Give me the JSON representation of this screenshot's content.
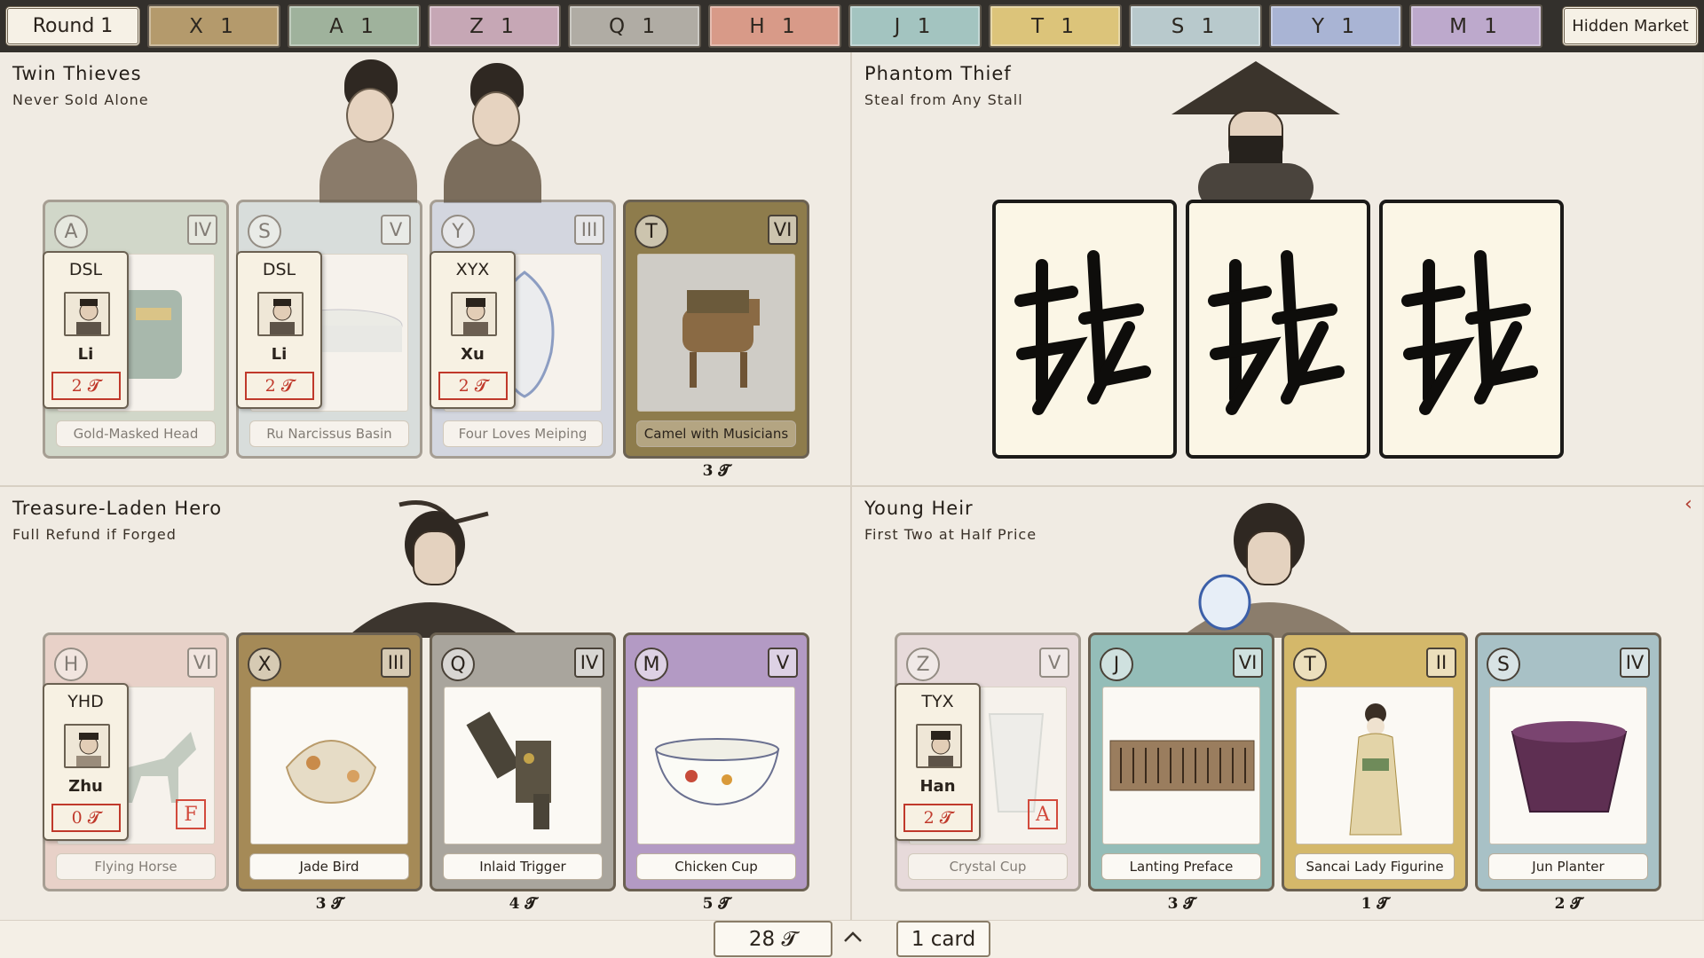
{
  "topbar": {
    "round_label": "Round 1",
    "hidden_market_label": "Hidden Market",
    "tabs": [
      {
        "label": "X 1",
        "color": "#b49a6c"
      },
      {
        "label": "A 1",
        "color": "#9fb29c"
      },
      {
        "label": "Z 1",
        "color": "#c6a7b5"
      },
      {
        "label": "Q 1",
        "color": "#b0aca4"
      },
      {
        "label": "H 1",
        "color": "#d89a88"
      },
      {
        "label": "J 1",
        "color": "#a3c4c0"
      },
      {
        "label": "T 1",
        "color": "#dcc47a"
      },
      {
        "label": "S 1",
        "color": "#b8c9cc"
      },
      {
        "label": "Y 1",
        "color": "#a9b4d4"
      },
      {
        "label": "M 1",
        "color": "#bda9cc"
      }
    ]
  },
  "quadrants": {
    "twin_thieves": {
      "title": "Twin Thieves",
      "subtitle": "Never Sold Alone",
      "cards": [
        {
          "letter": "A",
          "numeral": "IV",
          "name": "Gold-Masked Head",
          "color": "#b9c8b4",
          "buyer": {
            "code": "DSL",
            "name": "Li",
            "price": "2 𝓣"
          }
        },
        {
          "letter": "S",
          "numeral": "V",
          "name": "Ru Narcissus Basin",
          "color": "#c6d2d5",
          "buyer": {
            "code": "DSL",
            "name": "Li",
            "price": "2 𝓣"
          }
        },
        {
          "letter": "Y",
          "numeral": "III",
          "name": "Four Loves Meiping",
          "color": "#bcc5dc",
          "buyer": {
            "code": "XYX",
            "name": "Xu",
            "price": "2 𝓣"
          }
        },
        {
          "letter": "T",
          "numeral": "VI",
          "name": "Camel with Musicians",
          "color": "#8e7c4c",
          "price": "3 𝓣"
        }
      ]
    },
    "phantom_thief": {
      "title": "Phantom Thief",
      "subtitle": "Steal from Any Stall"
    },
    "treasure_hero": {
      "title": "Treasure-Laden Hero",
      "subtitle": "Full Refund if Forged",
      "cards": [
        {
          "letter": "H",
          "numeral": "VI",
          "name": "Flying Horse",
          "color": "#e2bdb2",
          "buyer": {
            "code": "YHD",
            "name": "Zhu",
            "price": "0 𝓣"
          },
          "stamp": "F"
        },
        {
          "letter": "X",
          "numeral": "III",
          "name": "Jade Bird",
          "color": "#a58a57",
          "price": "3 𝓣"
        },
        {
          "letter": "Q",
          "numeral": "IV",
          "name": "Inlaid Trigger",
          "color": "#a9a59d",
          "price": "4 𝓣"
        },
        {
          "letter": "M",
          "numeral": "V",
          "name": "Chicken Cup",
          "color": "#b39ac4",
          "price": "5 𝓣"
        }
      ]
    },
    "young_heir": {
      "title": "Young Heir",
      "subtitle": "First Two at Half Price",
      "cards": [
        {
          "letter": "Z",
          "numeral": "V",
          "name": "Crystal Cup",
          "color": "#e0cdd3",
          "buyer": {
            "code": "TYX",
            "name": "Han",
            "price": "2 𝓣"
          },
          "stamp": "A"
        },
        {
          "letter": "J",
          "numeral": "VI",
          "name": "Lanting Preface",
          "color": "#94bdb8",
          "price": "3 𝓣"
        },
        {
          "letter": "T",
          "numeral": "II",
          "name": "Sancai Lady Figurine",
          "color": "#d4b86a",
          "price": "1 𝓣"
        },
        {
          "letter": "S",
          "numeral": "IV",
          "name": "Jun Planter",
          "color": "#a8c1c6",
          "price": "2 𝓣"
        }
      ]
    }
  },
  "footer": {
    "money": "28 𝓣",
    "cards": "1 card"
  }
}
